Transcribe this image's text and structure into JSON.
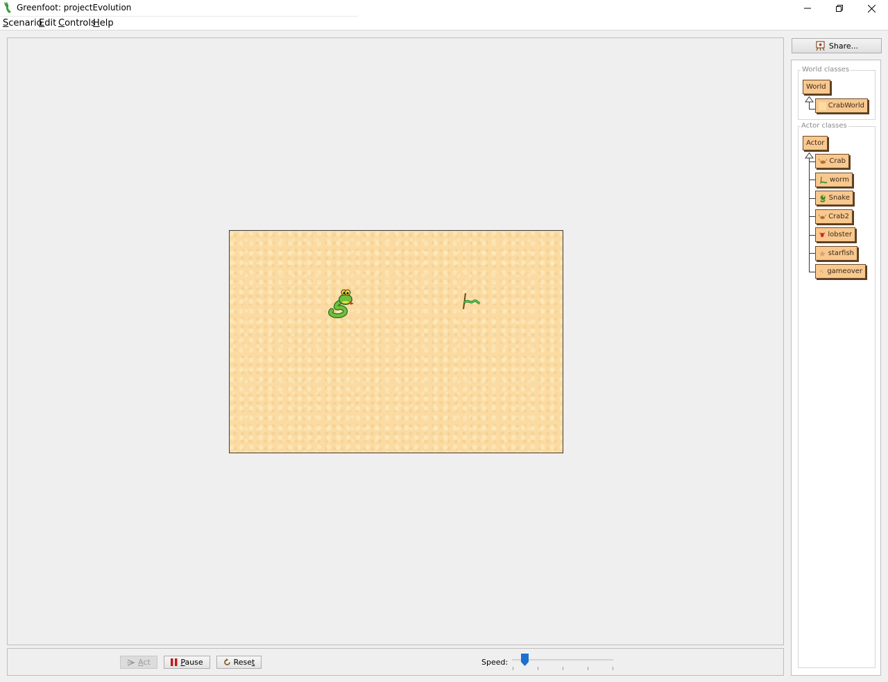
{
  "window": {
    "title": "Greenfoot: projectEvolution",
    "app_icon": "greenfoot-foot-icon"
  },
  "menu": [
    {
      "mnemonic": "S",
      "rest": "cenario"
    },
    {
      "mnemonic": "E",
      "rest": "dit"
    },
    {
      "mnemonic": "C",
      "rest": "ontrols"
    },
    {
      "mnemonic": "H",
      "rest": "elp"
    }
  ],
  "world": {
    "actors": [
      {
        "name": "snake",
        "icon": "snake-icon"
      },
      {
        "name": "worm",
        "icon": "worm-icon"
      }
    ],
    "background_color": "#fbdba2"
  },
  "controls": {
    "act": {
      "mnemonic": "A",
      "rest": "ct",
      "enabled": false
    },
    "pause": {
      "mnemonic": "P",
      "rest": "ause"
    },
    "reset": {
      "pre": "Rese",
      "mnemonic": "t"
    },
    "speed_label": "Speed:",
    "speed_value": 0.12
  },
  "share": {
    "label": "Share..."
  },
  "world_classes": {
    "title": "World classes",
    "root": "World",
    "children": [
      "CrabWorld"
    ]
  },
  "actor_classes": {
    "title": "Actor classes",
    "root": "Actor",
    "children": [
      "Crab",
      "worm",
      "Snake",
      "Crab2",
      "lobster",
      "starfish",
      "gameover"
    ]
  },
  "colors": {
    "class_box": "#f8c88e",
    "speed_thumb": "#1e6fd0"
  }
}
